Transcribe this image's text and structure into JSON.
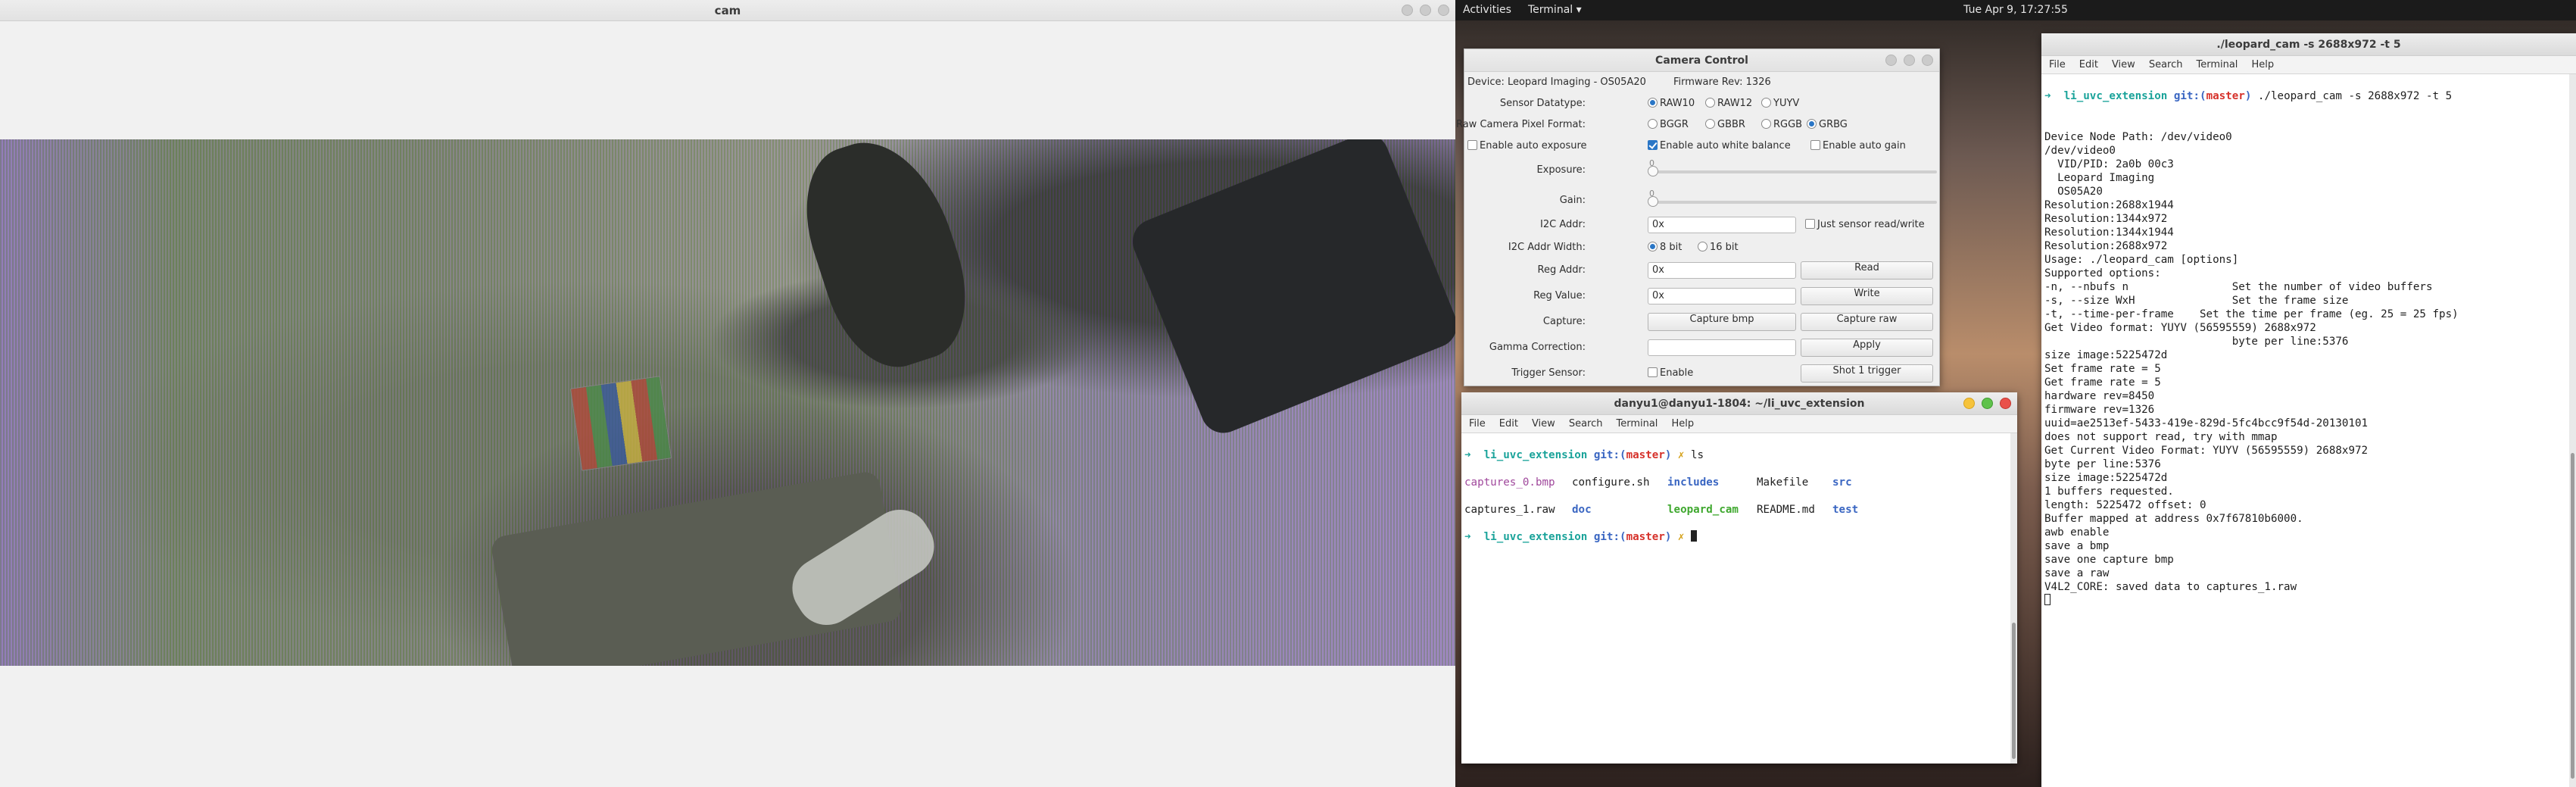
{
  "cam_window": {
    "title": "cam"
  },
  "topbar": {
    "activities": "Activities",
    "app_menu": "Terminal ▾",
    "clock": "Tue Apr  9, 17:27:55"
  },
  "camera_control": {
    "title": "Camera Control",
    "device": "Device: Leopard Imaging - OS05A20",
    "firmware": "Firmware Rev: 1326",
    "sensor_datatype": {
      "label": "Sensor Datatype:",
      "options": [
        "RAW10",
        "RAW12",
        "YUYV"
      ],
      "selected": "RAW10"
    },
    "pixel_format": {
      "label": "Raw Camera Pixel Format:",
      "options": [
        "BGGR",
        "GBBR",
        "RGGB",
        "GRBG"
      ],
      "selected": "GRBG"
    },
    "auto_exposure": "Enable auto exposure",
    "auto_white_balance": "Enable auto white balance",
    "auto_gain": "Enable auto gain",
    "exposure": {
      "label": "Exposure:",
      "value": "0"
    },
    "gain": {
      "label": "Gain:",
      "value": "0"
    },
    "i2c_addr": {
      "label": "I2C Addr:",
      "value": "0x",
      "checkbox": "Just sensor read/write"
    },
    "i2c_width": {
      "label": "I2C Addr Width:",
      "options": [
        "8 bit",
        "16 bit"
      ],
      "selected": "8 bit"
    },
    "reg_addr": {
      "label": "Reg Addr:",
      "value": "0x",
      "button": "Read"
    },
    "reg_value": {
      "label": "Reg Value:",
      "value": "0x",
      "button": "Write"
    },
    "capture": {
      "label": "Capture:",
      "btn_bmp": "Capture bmp",
      "btn_raw": "Capture raw"
    },
    "gamma": {
      "label": "Gamma Correction:",
      "value": "",
      "button": "Apply"
    },
    "trigger": {
      "label": "Trigger Sensor:",
      "checkbox": "Enable",
      "button": "Shot 1 trigger"
    }
  },
  "terminal_small": {
    "title": "danyu1@danyu1-1804: ~/li_uvc_extension",
    "menu": [
      "File",
      "Edit",
      "View",
      "Search",
      "Terminal",
      "Help"
    ],
    "prompt_dir": "li_uvc_extension",
    "git": "git:(",
    "branch": "master",
    "git_close": ")",
    "mark": "✗",
    "cmd": "ls",
    "ls": [
      [
        "captures_0.bmp",
        "configure.sh",
        "includes",
        "Makefile",
        "src"
      ],
      [
        "captures_1.raw",
        "doc",
        "leopard_cam",
        "README.md",
        "test"
      ]
    ]
  },
  "terminal_big": {
    "title": "./leopard_cam -s 2688x972 -t 5",
    "menu": [
      "File",
      "Edit",
      "View",
      "Search",
      "Terminal",
      "Help"
    ],
    "prompt_dir": "li_uvc_extension",
    "git": "git:(",
    "branch": "master",
    "git_close": ")",
    "cmd": "./leopard_cam -s 2688x972 -t 5",
    "lines": [
      "Device Node Path: /dev/video0",
      "/dev/video0",
      "  VID/PID: 2a0b 00c3",
      "  Leopard Imaging",
      "  OS05A20",
      "Resolution:2688x1944",
      "Resolution:1344x972",
      "Resolution:1344x1944",
      "Resolution:2688x972",
      "Usage: ./leopard_cam [options]",
      "Supported options:",
      "-n, --nbufs n                Set the number of video buffers",
      "-s, --size WxH               Set the frame size",
      "-t, --time-per-frame    Set the time per frame (eg. 25 = 25 fps)",
      "Get Video format: YUYV (56595559) 2688x972",
      "                             byte per line:5376",
      "size image:5225472d",
      "Set frame rate = 5",
      "Get frame rate = 5",
      "hardware rev=8450",
      "firmware rev=1326",
      "uuid=ae2513ef-5433-419e-829d-5fc4bcc9f54d-20130101",
      "does not support read, try with mmap",
      "Get Current Video Format: YUYV (56595559) 2688x972",
      "byte per line:5376",
      "size image:5225472d",
      "1 buffers requested.",
      "length: 5225472 offset: 0",
      "Buffer mapped at address 0x7f67810b6000.",
      "awb enable",
      "save a bmp",
      "save one capture bmp",
      "save a raw",
      "V4L2_CORE: saved data to captures_1.raw"
    ]
  }
}
